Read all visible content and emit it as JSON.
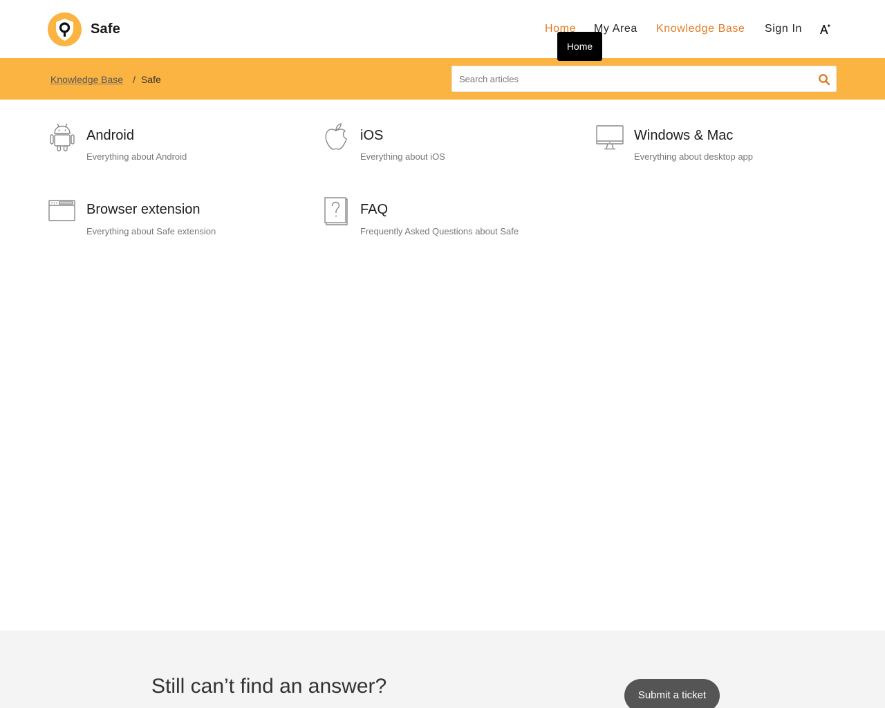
{
  "brand": {
    "name": "Safe",
    "accent": "#fbb342",
    "link_color": "#e07b24"
  },
  "nav": {
    "home": "Home",
    "my_area": "My Area",
    "knowledge_base": "Knowledge Base",
    "sign_in": "Sign In",
    "accessibility_icon": "font-size-icon"
  },
  "tooltip": {
    "text": "Home"
  },
  "breadcrumb": {
    "root": "Knowledge Base",
    "separator": "/",
    "current": "Safe"
  },
  "search": {
    "placeholder": "Search articles",
    "icon": "search-icon"
  },
  "categories": [
    {
      "title": "Android",
      "description": "Everything about Android",
      "icon": "android-icon"
    },
    {
      "title": "iOS",
      "description": "Everything about iOS",
      "icon": "apple-icon"
    },
    {
      "title": "Windows & Mac",
      "description": "Everything about desktop app",
      "icon": "monitor-icon"
    },
    {
      "title": "Browser extension",
      "description": "Everything about Safe extension",
      "icon": "browser-window-icon"
    },
    {
      "title": "FAQ",
      "description": "Frequently Asked Questions about Safe",
      "icon": "question-document-icon"
    }
  ],
  "footer": {
    "title": "Still can’t find an answer?",
    "button": "Submit a ticket"
  }
}
